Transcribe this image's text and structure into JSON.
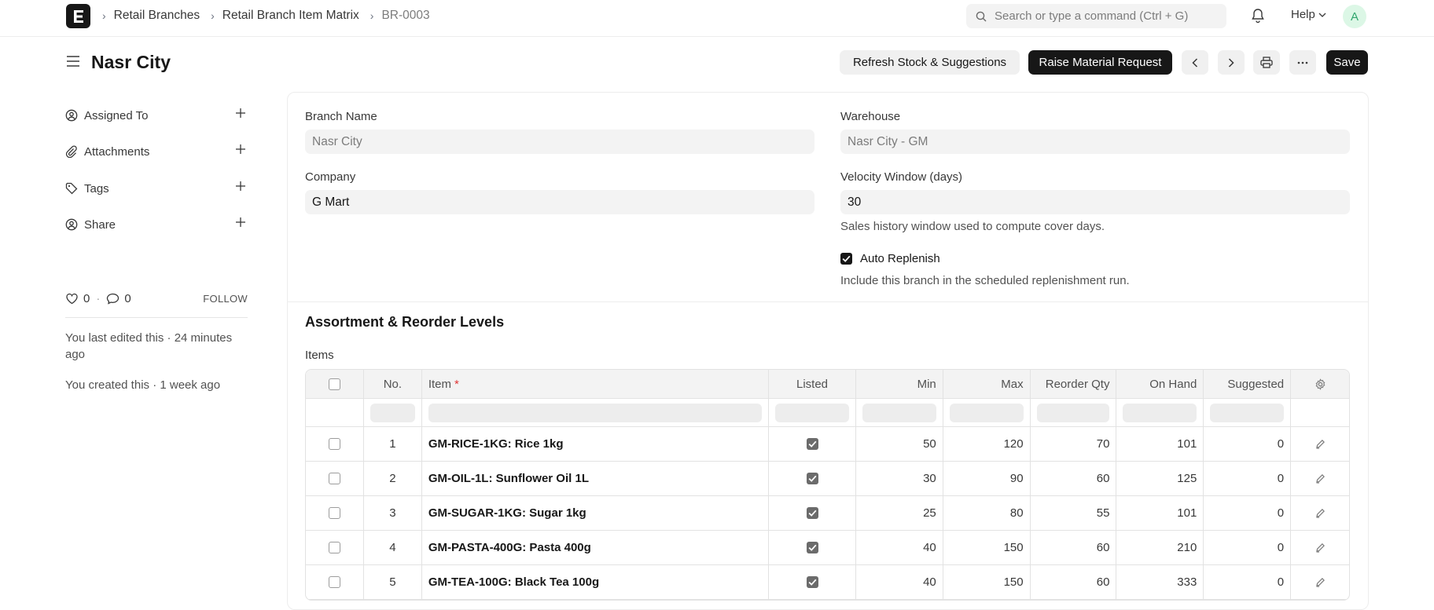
{
  "nav": {
    "breadcrumbs": [
      "Retail Branches",
      "Retail Branch Item Matrix",
      "BR-0003"
    ],
    "search_placeholder": "Search or type a command (Ctrl + G)",
    "help_label": "Help",
    "avatar_initial": "A"
  },
  "header": {
    "title": "Nasr City",
    "refresh_label": "Refresh Stock & Suggestions",
    "raise_label": "Raise Material Request",
    "save_label": "Save"
  },
  "sidebar": {
    "items": [
      {
        "label": "Assigned To",
        "icon": "user-circle-icon"
      },
      {
        "label": "Attachments",
        "icon": "paperclip-icon"
      },
      {
        "label": "Tags",
        "icon": "tag-icon"
      },
      {
        "label": "Share",
        "icon": "share-user-icon"
      }
    ],
    "likes": "0",
    "comments": "0",
    "follow_label": "FOLLOW",
    "last_edited": "You last edited this · 24 minutes ago",
    "created": "You created this · 1 week ago"
  },
  "form": {
    "branch_name_label": "Branch Name",
    "branch_name_value": "Nasr City",
    "warehouse_label": "Warehouse",
    "warehouse_value": "Nasr City - GM",
    "company_label": "Company",
    "company_value": "G Mart",
    "velocity_label": "Velocity Window (days)",
    "velocity_value": "30",
    "velocity_desc": "Sales history window used to compute cover days.",
    "auto_replenish_label": "Auto Replenish",
    "auto_replenish_checked": true,
    "auto_replenish_desc": "Include this branch in the scheduled replenishment run.",
    "section_title": "Assortment & Reorder Levels",
    "items_label": "Items"
  },
  "table": {
    "headers": [
      "No.",
      "Item",
      "Listed",
      "Min",
      "Max",
      "Reorder Qty",
      "On Hand",
      "Suggested"
    ],
    "rows": [
      {
        "no": "1",
        "item": "GM-RICE-1KG: Rice 1kg",
        "listed": true,
        "min": "50",
        "max": "120",
        "reorder": "70",
        "on_hand": "101",
        "suggested": "0"
      },
      {
        "no": "2",
        "item": "GM-OIL-1L: Sunflower Oil 1L",
        "listed": true,
        "min": "30",
        "max": "90",
        "reorder": "60",
        "on_hand": "125",
        "suggested": "0"
      },
      {
        "no": "3",
        "item": "GM-SUGAR-1KG: Sugar 1kg",
        "listed": true,
        "min": "25",
        "max": "80",
        "reorder": "55",
        "on_hand": "101",
        "suggested": "0"
      },
      {
        "no": "4",
        "item": "GM-PASTA-400G: Pasta 400g",
        "listed": true,
        "min": "40",
        "max": "150",
        "reorder": "60",
        "on_hand": "210",
        "suggested": "0"
      },
      {
        "no": "5",
        "item": "GM-TEA-100G: Black Tea 100g",
        "listed": true,
        "min": "40",
        "max": "150",
        "reorder": "60",
        "on_hand": "333",
        "suggested": "0"
      }
    ]
  }
}
